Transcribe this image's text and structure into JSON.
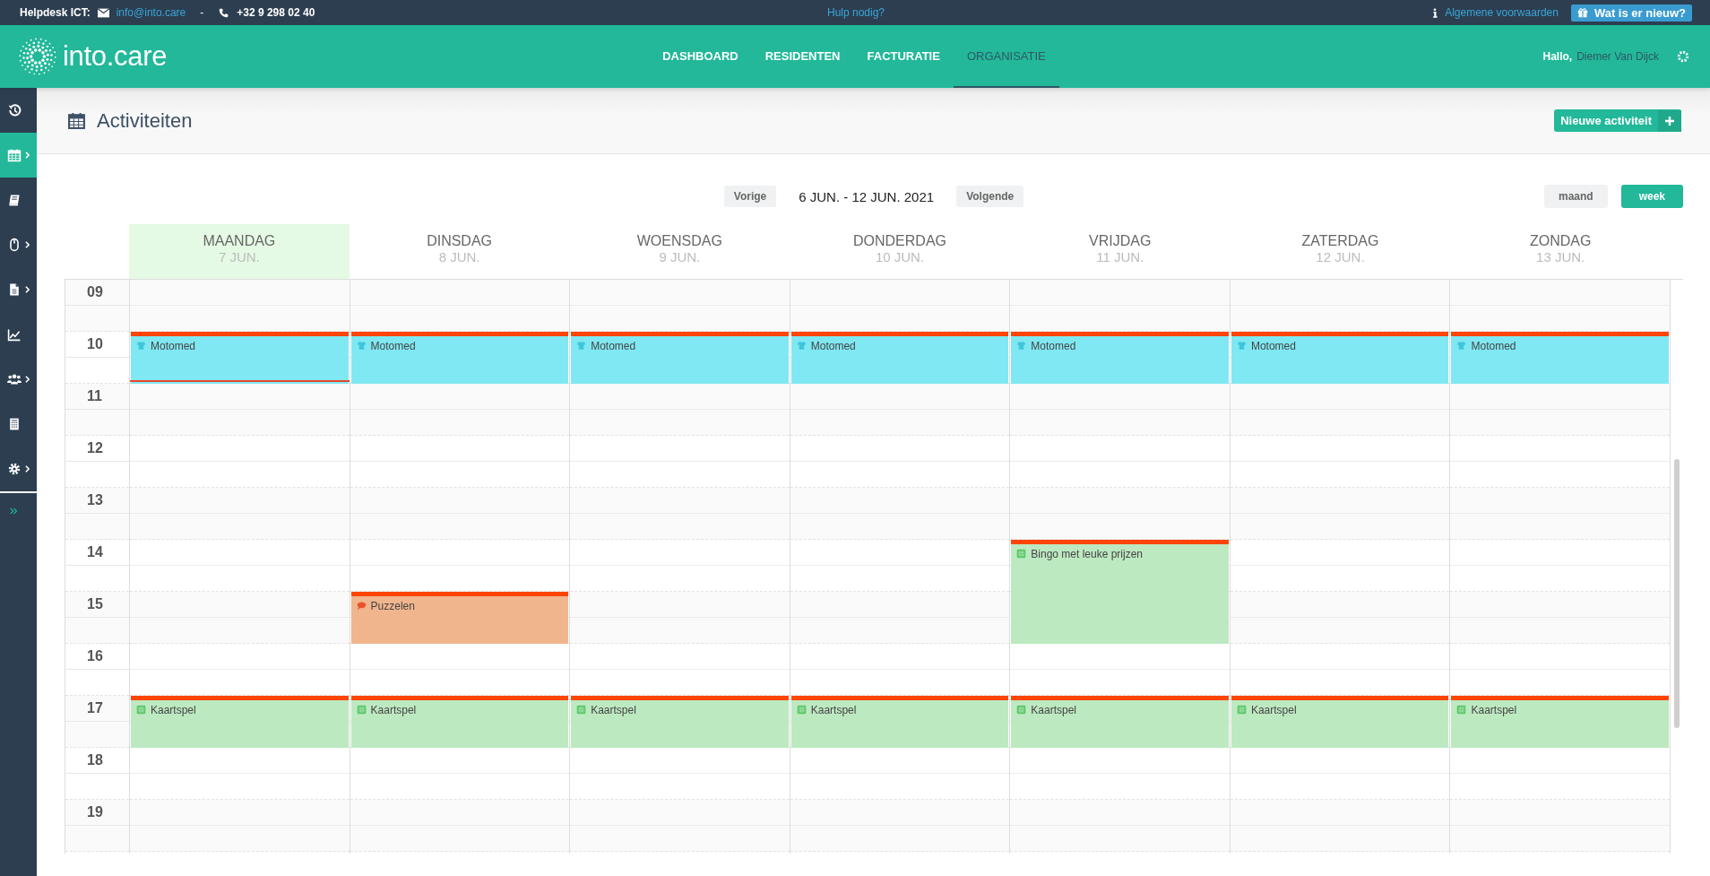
{
  "topbar": {
    "helpdesk_label": "Helpdesk ICT:",
    "email": "info@into.care",
    "separator": "-",
    "phone": "+32 9 298 02 40",
    "help_link": "Hulp nodig?",
    "terms_link": "Algemene voorwaarden",
    "news_button": "Wat is er nieuw?"
  },
  "header": {
    "logo_text": "into.care",
    "nav": [
      {
        "label": "DASHBOARD",
        "selected": false
      },
      {
        "label": "RESIDENTEN",
        "selected": false
      },
      {
        "label": "FACTURATIE",
        "selected": false
      },
      {
        "label": "ORGANISATIE",
        "selected": true
      }
    ],
    "greeting": "Hallo,",
    "user": "Diemer Van Dijck"
  },
  "sidebar": {
    "items": [
      {
        "kind": "history",
        "selected": false,
        "submenu": false
      },
      {
        "kind": "calendar",
        "selected": true,
        "submenu": true
      },
      {
        "kind": "book",
        "selected": false,
        "submenu": false
      },
      {
        "kind": "mouse",
        "selected": false,
        "submenu": true
      },
      {
        "kind": "document",
        "selected": false,
        "submenu": true
      },
      {
        "kind": "chart",
        "selected": false,
        "submenu": false
      },
      {
        "kind": "users",
        "selected": false,
        "submenu": true
      },
      {
        "kind": "calculator",
        "selected": false,
        "submenu": false
      },
      {
        "kind": "gear",
        "selected": false,
        "submenu": true
      }
    ]
  },
  "page": {
    "title": "Activiteiten",
    "new_button": "Nieuwe activiteit"
  },
  "calendar": {
    "prev_button": "Vorige",
    "range": "6 JUN. - 12 JUN. 2021",
    "next_button": "Volgende",
    "views": [
      {
        "label": "maand",
        "selected": false
      },
      {
        "label": "week",
        "selected": true
      }
    ],
    "hours": [
      "09",
      "10",
      "11",
      "12",
      "13",
      "14",
      "15",
      "16",
      "17",
      "18",
      "19"
    ],
    "days": [
      {
        "name": "MAANDAG",
        "date": "7 JUN.",
        "today": true,
        "slots": [
          {
            "kind": "free"
          },
          {
            "kind": "exercise",
            "title": "Motomed",
            "color": "#80e8f2",
            "now_line": true
          },
          {
            "kind": "free"
          },
          {
            "kind": "free"
          },
          {
            "kind": "free"
          },
          {
            "kind": "free"
          },
          {
            "kind": "free"
          },
          {
            "kind": "free"
          },
          {
            "kind": "game",
            "title": "Kaartspel",
            "color": "#bde9c0",
            "now_line": false
          },
          {
            "kind": "free"
          },
          {
            "kind": "free"
          }
        ]
      },
      {
        "name": "DINSDAG",
        "date": "8 JUN.",
        "today": false,
        "slots": [
          {
            "kind": "free"
          },
          {
            "kind": "exercise",
            "title": "Motomed",
            "color": "#80e8f2",
            "now_line": false
          },
          {
            "kind": "free"
          },
          {
            "kind": "free"
          },
          {
            "kind": "free"
          },
          {
            "kind": "free"
          },
          {
            "kind": "talk",
            "title": "Puzzelen",
            "color": "#f1b58d",
            "now_line": false
          },
          {
            "kind": "free"
          },
          {
            "kind": "game",
            "title": "Kaartspel",
            "color": "#bde9c0",
            "now_line": false
          },
          {
            "kind": "free"
          },
          {
            "kind": "free"
          }
        ]
      },
      {
        "name": "WOENSDAG",
        "date": "9 JUN.",
        "today": false,
        "slots": [
          {
            "kind": "free"
          },
          {
            "kind": "exercise",
            "title": "Motomed",
            "color": "#80e8f2",
            "now_line": false
          },
          {
            "kind": "free"
          },
          {
            "kind": "free"
          },
          {
            "kind": "free"
          },
          {
            "kind": "free"
          },
          {
            "kind": "free"
          },
          {
            "kind": "free"
          },
          {
            "kind": "game",
            "title": "Kaartspel",
            "color": "#bde9c0",
            "now_line": false
          },
          {
            "kind": "free"
          },
          {
            "kind": "free"
          }
        ]
      },
      {
        "name": "DONDERDAG",
        "date": "10 JUN.",
        "today": false,
        "slots": [
          {
            "kind": "free"
          },
          {
            "kind": "exercise",
            "title": "Motomed",
            "color": "#80e8f2",
            "now_line": false
          },
          {
            "kind": "free"
          },
          {
            "kind": "free"
          },
          {
            "kind": "free"
          },
          {
            "kind": "free"
          },
          {
            "kind": "free"
          },
          {
            "kind": "free"
          },
          {
            "kind": "game",
            "title": "Kaartspel",
            "color": "#bde9c0",
            "now_line": false
          },
          {
            "kind": "free"
          },
          {
            "kind": "free"
          }
        ]
      },
      {
        "name": "VRIJDAG",
        "date": "11 JUN.",
        "today": false,
        "slots": [
          {
            "kind": "free"
          },
          {
            "kind": "exercise",
            "title": "Motomed",
            "color": "#80e8f2",
            "now_line": false
          },
          {
            "kind": "free"
          },
          {
            "kind": "free"
          },
          {
            "kind": "free"
          },
          {
            "kind": "game",
            "title": "Bingo met leuke prijzen",
            "color": "#bde9c0",
            "now_line": false
          },
          {
            "kind": "continued"
          },
          {
            "kind": "free"
          },
          {
            "kind": "game",
            "title": "Kaartspel",
            "color": "#bde9c0",
            "now_line": false
          },
          {
            "kind": "free"
          },
          {
            "kind": "free"
          }
        ]
      },
      {
        "name": "ZATERDAG",
        "date": "12 JUN.",
        "today": false,
        "slots": [
          {
            "kind": "free"
          },
          {
            "kind": "exercise",
            "title": "Motomed",
            "color": "#80e8f2",
            "now_line": false
          },
          {
            "kind": "free"
          },
          {
            "kind": "free"
          },
          {
            "kind": "free"
          },
          {
            "kind": "free"
          },
          {
            "kind": "free"
          },
          {
            "kind": "free"
          },
          {
            "kind": "game",
            "title": "Kaartspel",
            "color": "#bde9c0",
            "now_line": false
          },
          {
            "kind": "free"
          },
          {
            "kind": "free"
          }
        ]
      },
      {
        "name": "ZONDAG",
        "date": "13 JUN.",
        "today": false,
        "slots": [
          {
            "kind": "free"
          },
          {
            "kind": "exercise",
            "title": "Motomed",
            "color": "#80e8f2",
            "now_line": false
          },
          {
            "kind": "free"
          },
          {
            "kind": "free"
          },
          {
            "kind": "free"
          },
          {
            "kind": "free"
          },
          {
            "kind": "free"
          },
          {
            "kind": "free"
          },
          {
            "kind": "game",
            "title": "Kaartspel",
            "color": "#bde9c0",
            "now_line": false
          },
          {
            "kind": "free"
          },
          {
            "kind": "free"
          }
        ]
      }
    ]
  }
}
